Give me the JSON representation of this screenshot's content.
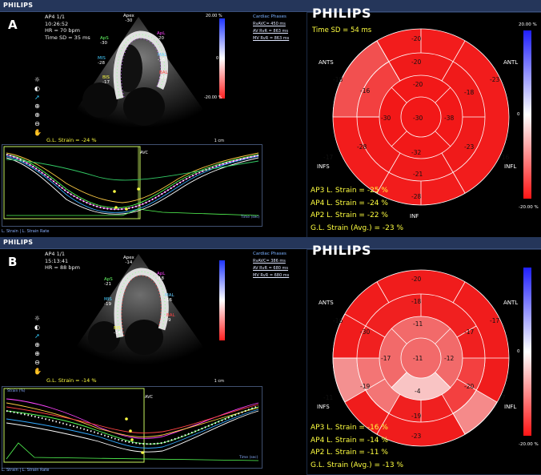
{
  "panels": [
    {
      "id": "A",
      "header": "PHILIPS",
      "letter": "A",
      "echo_info": [
        "AP4  1/1",
        "10:26:52",
        "HR = 70 bpm",
        "Time SD = 35 ms"
      ],
      "phases_title": "Cardiac Phases",
      "phases": [
        "RvAVC= 450 ms",
        "AV RvR = 863 ms",
        "MV RvR = 863 ms"
      ],
      "colorbar": {
        "top": "20.00 %",
        "bottom": "-20.00 %",
        "mid": "0"
      },
      "global_strain": "G.L. Strain = -24 %",
      "scale_label": "1 cm",
      "segment_labels": [
        {
          "name": "Apex",
          "value": "-30"
        },
        {
          "name": "ApS",
          "value": "-30"
        },
        {
          "name": "MIS",
          "value": "-28"
        },
        {
          "name": "BIS",
          "value": "-17"
        },
        {
          "name": "ApL",
          "value": "-20"
        },
        {
          "name": "MAL",
          "value": "-18"
        },
        {
          "name": "BAL",
          "value": "-23"
        }
      ],
      "graph": {
        "avc": "AVC",
        "time_label": "Time (sec)",
        "tabs": "L. Strain | L. Strain Rate"
      },
      "bullseye": {
        "brand": "PHILIPS",
        "time_sd": "Time SD = 54 ms",
        "labels": [
          "ANTS",
          "ANTL",
          "INFS",
          "INFL",
          "INF"
        ],
        "outer": [
          "-20",
          "-23",
          "-16",
          "-28",
          "-17",
          "-18"
        ],
        "middle": [
          "-20",
          "-18",
          "-23",
          "-32",
          "-28",
          "-16"
        ],
        "inner": [
          "-20",
          "-38",
          "-21",
          "-30"
        ],
        "apex": "-30",
        "colorbar_top": "20.00 %",
        "colorbar_bottom": "-20.00 %",
        "colorbar_mid": "0",
        "summary": [
          "AP3 L. Strain = -25 %",
          "AP4 L. Strain = -24 %",
          "AP2 L. Strain = -22 %",
          "G.L. Strain (Avg.) = -23 %"
        ]
      }
    },
    {
      "id": "B",
      "header": "PHILIPS",
      "letter": "B",
      "echo_info": [
        "AP4  1/1",
        "15:13:41",
        "HR = 88 bpm"
      ],
      "phases_title": "Cardiac Phases",
      "phases": [
        "RvAVC= 386 ms",
        "AV RvR = 680 ms",
        "MV RvR = 680 ms"
      ],
      "colorbar": {
        "top": "20.00 %",
        "bottom": "-20.00 %",
        "mid": "0"
      },
      "global_strain": "G.L. Strain = -14 %",
      "scale_label": "1 cm",
      "segment_labels": [
        {
          "name": "Apex",
          "value": "-14"
        },
        {
          "name": "ApS",
          "value": "-21"
        },
        {
          "name": "MIS",
          "value": "-19"
        },
        {
          "name": "BIS",
          "value": "-14"
        },
        {
          "name": "ApL",
          "value": "-18"
        },
        {
          "name": "MAL",
          "value": "-16"
        },
        {
          "name": "BAL",
          "value": "-9"
        }
      ],
      "graph": {
        "strain_label": "Strain (%)",
        "avc": "AVC",
        "time_label": "Time (sec)",
        "tabs": "L. Strain | L. Strain Rate"
      },
      "bullseye": {
        "brand": "PHILIPS",
        "labels": [
          "ANTS",
          "ANTL",
          "INFS",
          "INFL"
        ],
        "outer": [
          "-20",
          "-17",
          "-7",
          "-23",
          "-11",
          "-16"
        ],
        "middle": [
          "-18",
          "-20",
          "-19",
          "-19",
          "-30"
        ],
        "inner": [
          "-11",
          "-12",
          "-4",
          "-17"
        ],
        "apex": "-11",
        "colorbar_top": "20.00 %",
        "colorbar_bottom": "-20.00 %",
        "colorbar_mid": "0",
        "summary": [
          "AP3 L. Strain = -16 %",
          "AP4 L. Strain = -14 %",
          "AP2 L. Strain = -11 %",
          "G.L. Strain (Avg.) = -13 %"
        ]
      }
    }
  ]
}
